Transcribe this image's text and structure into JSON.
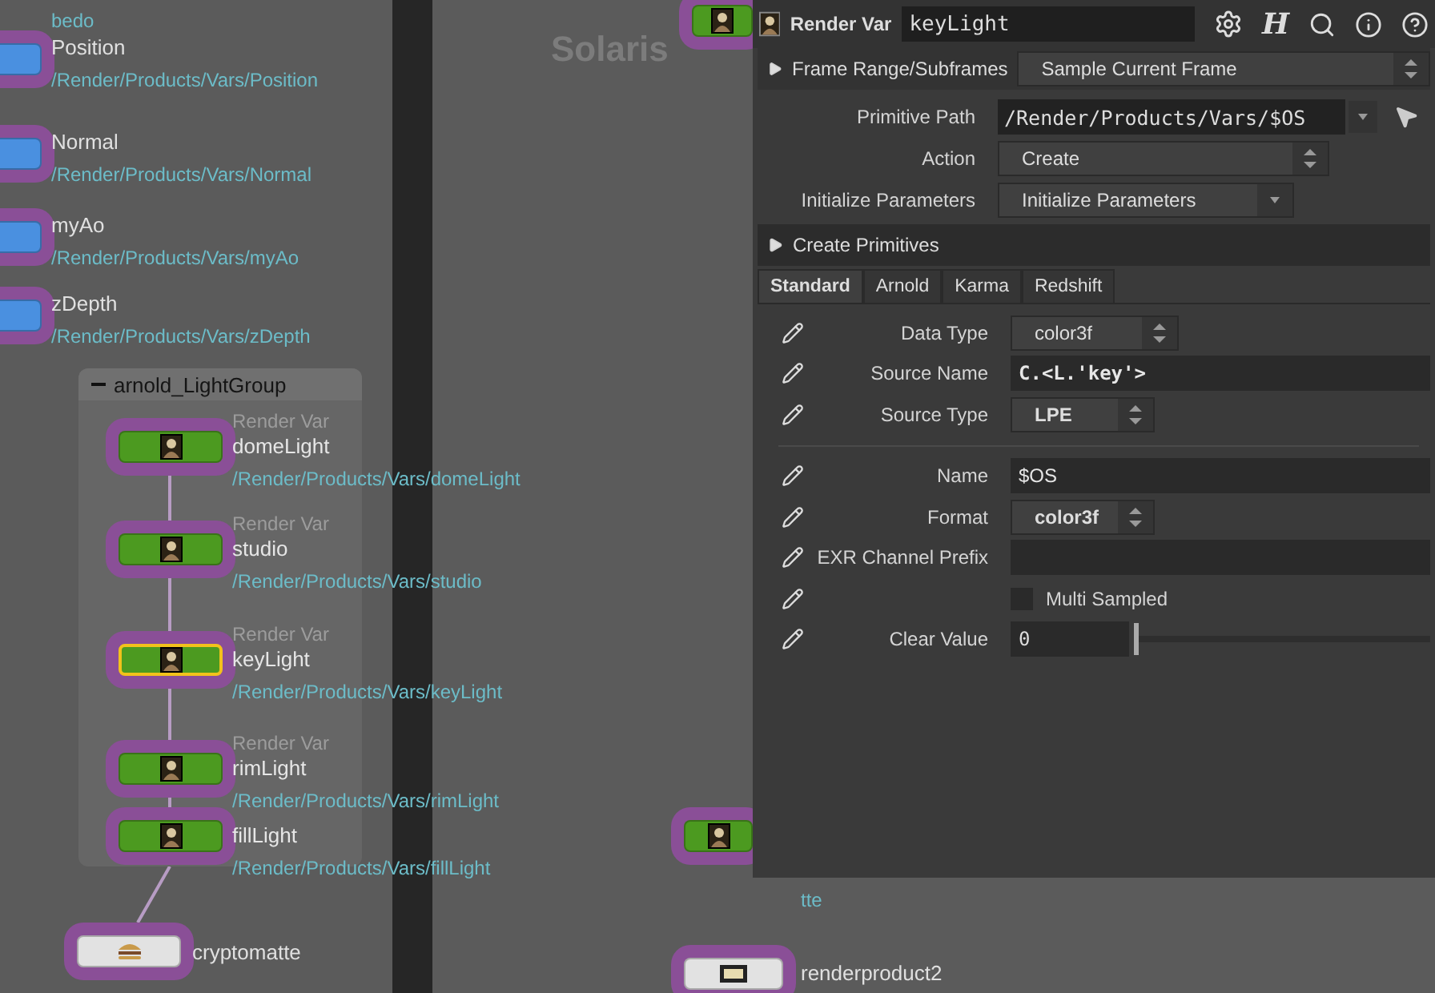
{
  "network_left": {
    "top_path_tail": "bedo",
    "nodes": [
      {
        "kind": "blue",
        "name": "Position",
        "path": "/Render/Products/Vars/Position"
      },
      {
        "kind": "blue",
        "name": "Normal",
        "path": "/Render/Products/Vars/Normal"
      },
      {
        "kind": "blue",
        "name": "myAo",
        "path": "/Render/Products/Vars/myAo"
      },
      {
        "kind": "blue",
        "name": "zDepth",
        "path": "/Render/Products/Vars/zDepth"
      }
    ],
    "group": {
      "title": "arnold_LightGroup",
      "expanded": true,
      "nodes": [
        {
          "kind": "green",
          "type_label": "Render Var",
          "name": "domeLight",
          "path": "/Render/Products/Vars/domeLight",
          "selected": false
        },
        {
          "kind": "green",
          "type_label": "Render Var",
          "name": "studio",
          "path": "/Render/Products/Vars/studio",
          "selected": false
        },
        {
          "kind": "green",
          "type_label": "Render Var",
          "name": "keyLight",
          "path": "/Render/Products/Vars/keyLight",
          "selected": true
        },
        {
          "kind": "green",
          "type_label": "Render Var",
          "name": "rimLight",
          "path": "/Render/Products/Vars/rimLight",
          "selected": false
        },
        {
          "kind": "green",
          "name": "fillLight",
          "path": "/Render/Products/Vars/fillLight",
          "selected": false
        }
      ]
    },
    "bottom_node": {
      "kind": "crypto",
      "name": "cryptomatte"
    }
  },
  "network_right": {
    "label": "Solaris",
    "path_tail": "tte",
    "node": {
      "kind": "product",
      "name": "renderproduct2"
    }
  },
  "parameters": {
    "header": {
      "type": "Render Var",
      "name": "keyLight",
      "logo": "H"
    },
    "frame_range": {
      "label": "Frame Range/Subframes",
      "expanded": false,
      "value": "Sample Current Frame"
    },
    "top_params": [
      {
        "label": "Primitive Path",
        "kind": "path",
        "value": "/Render/Products/Vars/$OS"
      },
      {
        "label": "Action",
        "kind": "spinner",
        "value": "Create"
      },
      {
        "label": "Initialize Parameters",
        "kind": "menu",
        "value": "Initialize Parameters"
      }
    ],
    "folder": {
      "label": "Create Primitives",
      "expanded": false
    },
    "tabs": [
      {
        "label": "Standard",
        "selected": true
      },
      {
        "label": "Arnold",
        "selected": false
      },
      {
        "label": "Karma",
        "selected": false
      },
      {
        "label": "Redshift",
        "selected": false
      }
    ],
    "sections": [
      [
        {
          "label": "Data Type",
          "kind": "spinner",
          "value": "color3f",
          "bold": false
        },
        {
          "label": "Source Name",
          "kind": "code",
          "value": "C.<L.'key'>",
          "bold": true
        },
        {
          "label": "Source Type",
          "kind": "spinner",
          "value": "LPE",
          "bold": true
        }
      ],
      [
        {
          "label": "Name",
          "kind": "text",
          "value": "$OS",
          "bold": false
        },
        {
          "label": "Format",
          "kind": "spinner",
          "value": "color3f",
          "bold": true
        },
        {
          "label": "EXR Channel Prefix",
          "kind": "text"
        },
        {
          "label": "Multi Sampled",
          "kind": "checkbox",
          "checked": false
        },
        {
          "label": "Clear Value",
          "kind": "slider",
          "value": "0",
          "level": 0
        }
      ]
    ]
  }
}
